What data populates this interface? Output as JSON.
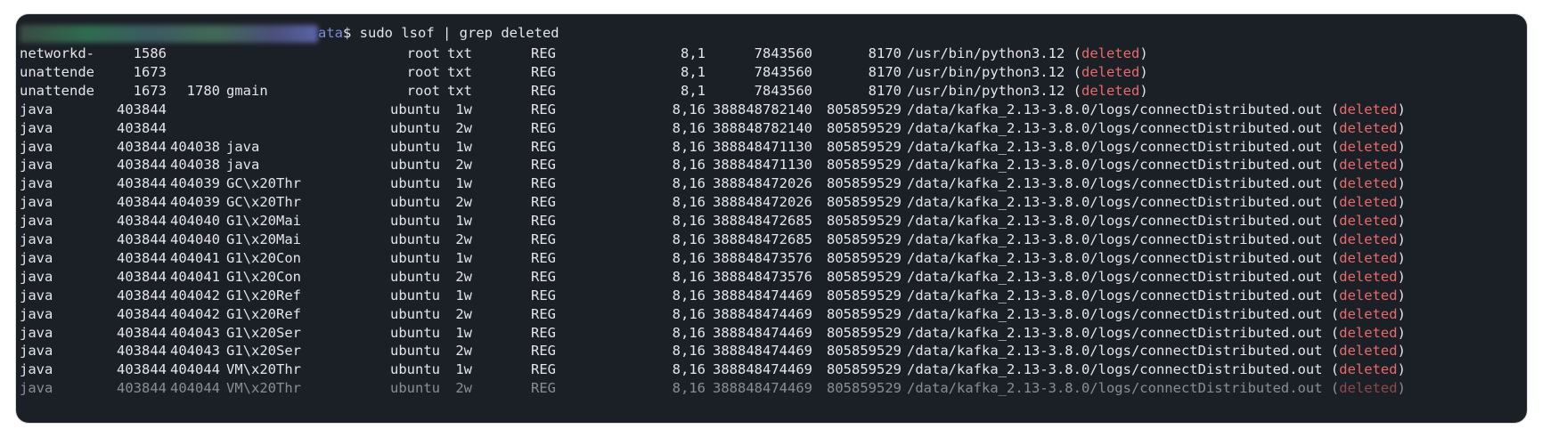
{
  "terminal": {
    "prompt_dir": "ata",
    "prompt_symbol": "$",
    "command": " sudo lsof | grep deleted",
    "deleted_word": "deleted",
    "colors": {
      "background": "#1b1f26",
      "text": "#e4e6ea",
      "deleted": "#ea6a6a",
      "prompt_dir": "#7f8bd8"
    },
    "rows": [
      {
        "cmd": "networkd-",
        "pid": "1586",
        "tid": "",
        "task": "",
        "user": "root",
        "fd": "txt",
        "type": "REG",
        "device": "8,1",
        "size": "7843560",
        "node": "8170",
        "name": "/usr/bin/python3.12"
      },
      {
        "cmd": "unattende",
        "pid": "1673",
        "tid": "",
        "task": "",
        "user": "root",
        "fd": "txt",
        "type": "REG",
        "device": "8,1",
        "size": "7843560",
        "node": "8170",
        "name": "/usr/bin/python3.12"
      },
      {
        "cmd": "unattende",
        "pid": "1673",
        "tid": "1780",
        "task": "gmain",
        "user": "root",
        "fd": "txt",
        "type": "REG",
        "device": "8,1",
        "size": "7843560",
        "node": "8170",
        "name": "/usr/bin/python3.12"
      },
      {
        "cmd": "java",
        "pid": "403844",
        "tid": "",
        "task": "",
        "user": "ubuntu",
        "fd": "1w",
        "type": "REG",
        "device": "8,16",
        "size": "388848782140",
        "node": "805859529",
        "name": "/data/kafka_2.13-3.8.0/logs/connectDistributed.out"
      },
      {
        "cmd": "java",
        "pid": "403844",
        "tid": "",
        "task": "",
        "user": "ubuntu",
        "fd": "2w",
        "type": "REG",
        "device": "8,16",
        "size": "388848782140",
        "node": "805859529",
        "name": "/data/kafka_2.13-3.8.0/logs/connectDistributed.out"
      },
      {
        "cmd": "java",
        "pid": "403844",
        "tid": "404038",
        "task": "java",
        "user": "ubuntu",
        "fd": "1w",
        "type": "REG",
        "device": "8,16",
        "size": "388848471130",
        "node": "805859529",
        "name": "/data/kafka_2.13-3.8.0/logs/connectDistributed.out"
      },
      {
        "cmd": "java",
        "pid": "403844",
        "tid": "404038",
        "task": "java",
        "user": "ubuntu",
        "fd": "2w",
        "type": "REG",
        "device": "8,16",
        "size": "388848471130",
        "node": "805859529",
        "name": "/data/kafka_2.13-3.8.0/logs/connectDistributed.out"
      },
      {
        "cmd": "java",
        "pid": "403844",
        "tid": "404039",
        "task": "GC\\x20Thr",
        "user": "ubuntu",
        "fd": "1w",
        "type": "REG",
        "device": "8,16",
        "size": "388848472026",
        "node": "805859529",
        "name": "/data/kafka_2.13-3.8.0/logs/connectDistributed.out"
      },
      {
        "cmd": "java",
        "pid": "403844",
        "tid": "404039",
        "task": "GC\\x20Thr",
        "user": "ubuntu",
        "fd": "2w",
        "type": "REG",
        "device": "8,16",
        "size": "388848472026",
        "node": "805859529",
        "name": "/data/kafka_2.13-3.8.0/logs/connectDistributed.out"
      },
      {
        "cmd": "java",
        "pid": "403844",
        "tid": "404040",
        "task": "G1\\x20Mai",
        "user": "ubuntu",
        "fd": "1w",
        "type": "REG",
        "device": "8,16",
        "size": "388848472685",
        "node": "805859529",
        "name": "/data/kafka_2.13-3.8.0/logs/connectDistributed.out"
      },
      {
        "cmd": "java",
        "pid": "403844",
        "tid": "404040",
        "task": "G1\\x20Mai",
        "user": "ubuntu",
        "fd": "2w",
        "type": "REG",
        "device": "8,16",
        "size": "388848472685",
        "node": "805859529",
        "name": "/data/kafka_2.13-3.8.0/logs/connectDistributed.out"
      },
      {
        "cmd": "java",
        "pid": "403844",
        "tid": "404041",
        "task": "G1\\x20Con",
        "user": "ubuntu",
        "fd": "1w",
        "type": "REG",
        "device": "8,16",
        "size": "388848473576",
        "node": "805859529",
        "name": "/data/kafka_2.13-3.8.0/logs/connectDistributed.out"
      },
      {
        "cmd": "java",
        "pid": "403844",
        "tid": "404041",
        "task": "G1\\x20Con",
        "user": "ubuntu",
        "fd": "2w",
        "type": "REG",
        "device": "8,16",
        "size": "388848473576",
        "node": "805859529",
        "name": "/data/kafka_2.13-3.8.0/logs/connectDistributed.out"
      },
      {
        "cmd": "java",
        "pid": "403844",
        "tid": "404042",
        "task": "G1\\x20Ref",
        "user": "ubuntu",
        "fd": "1w",
        "type": "REG",
        "device": "8,16",
        "size": "388848474469",
        "node": "805859529",
        "name": "/data/kafka_2.13-3.8.0/logs/connectDistributed.out"
      },
      {
        "cmd": "java",
        "pid": "403844",
        "tid": "404042",
        "task": "G1\\x20Ref",
        "user": "ubuntu",
        "fd": "2w",
        "type": "REG",
        "device": "8,16",
        "size": "388848474469",
        "node": "805859529",
        "name": "/data/kafka_2.13-3.8.0/logs/connectDistributed.out"
      },
      {
        "cmd": "java",
        "pid": "403844",
        "tid": "404043",
        "task": "G1\\x20Ser",
        "user": "ubuntu",
        "fd": "1w",
        "type": "REG",
        "device": "8,16",
        "size": "388848474469",
        "node": "805859529",
        "name": "/data/kafka_2.13-3.8.0/logs/connectDistributed.out"
      },
      {
        "cmd": "java",
        "pid": "403844",
        "tid": "404043",
        "task": "G1\\x20Ser",
        "user": "ubuntu",
        "fd": "2w",
        "type": "REG",
        "device": "8,16",
        "size": "388848474469",
        "node": "805859529",
        "name": "/data/kafka_2.13-3.8.0/logs/connectDistributed.out"
      },
      {
        "cmd": "java",
        "pid": "403844",
        "tid": "404044",
        "task": "VM\\x20Thr",
        "user": "ubuntu",
        "fd": "1w",
        "type": "REG",
        "device": "8,16",
        "size": "388848474469",
        "node": "805859529",
        "name": "/data/kafka_2.13-3.8.0/logs/connectDistributed.out"
      },
      {
        "cmd": "java",
        "pid": "403844",
        "tid": "404044",
        "task": "VM\\x20Thr",
        "user": "ubuntu",
        "fd": "2w",
        "type": "REG",
        "device": "8,16",
        "size": "388848474469",
        "node": "805859529",
        "name": "/data/kafka_2.13-3.8.0/logs/connectDistributed.out"
      }
    ]
  }
}
